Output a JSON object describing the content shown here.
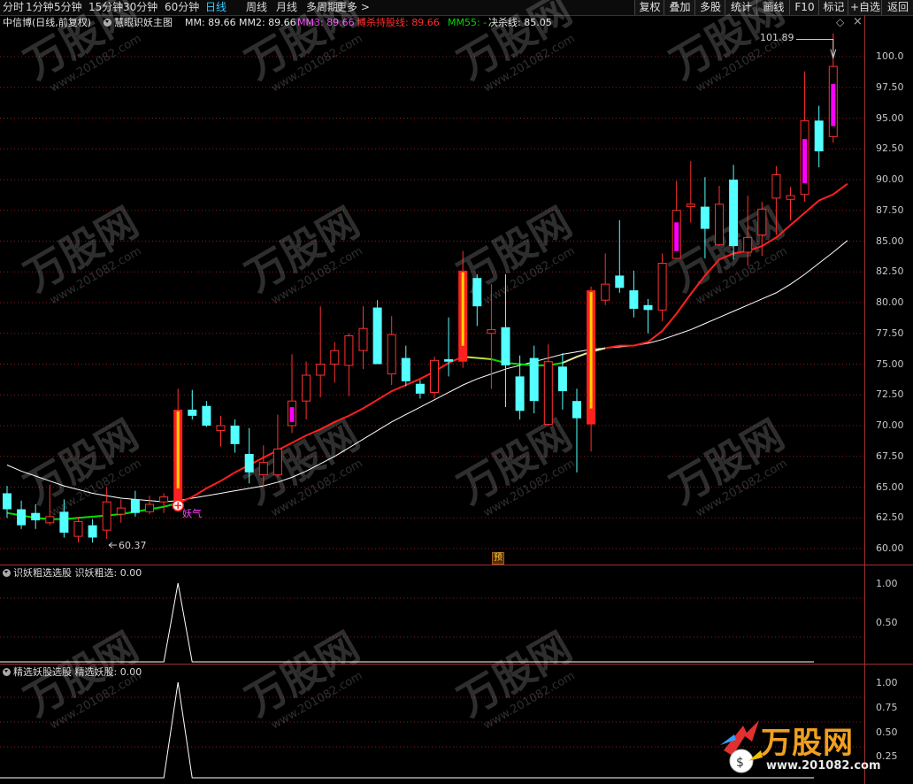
{
  "topbar": {
    "periods": [
      "分时",
      "1分钟",
      "5分钟",
      "15分钟",
      "30分钟",
      "60分钟",
      "日线",
      "周线",
      "月线",
      "多周期",
      "更多 >"
    ],
    "active_period": "日线",
    "right_buttons": [
      "复权",
      "叠加",
      "多股",
      "统计",
      "画线",
      "F10",
      "标记",
      "+自选",
      "返回"
    ]
  },
  "indicator_line": {
    "stock": "中信博(日线,前复权)",
    "indicator_name": "慧眼识妖主图",
    "mm": "MM: 89.66",
    "mm2": "MM2: 89.66",
    "mm3": "MM3: 89.66",
    "bosha": "博杀持股线: 89.66",
    "mm55": "MM55: -",
    "jueshaxian": "决杀线: 85.05"
  },
  "main_chart": {
    "y_ticks": [
      "100.0",
      "97.50",
      "95.00",
      "92.50",
      "90.00",
      "87.50",
      "85.00",
      "82.50",
      "80.00",
      "77.50",
      "75.00",
      "72.50",
      "70.00",
      "67.50",
      "65.00",
      "62.50",
      "60.00"
    ],
    "high_label": "101.89",
    "low_label": "60.37",
    "signal_label": "妖气",
    "pre_marker": "预"
  },
  "pane1": {
    "title": "识妖粗选选股",
    "value": "识妖粗选: 0.00",
    "y_ticks": [
      "1.00",
      "0.50"
    ]
  },
  "pane2": {
    "title": "精选妖股选股",
    "value": "精选妖股: 0.00",
    "y_ticks": [
      "1.00",
      "0.75",
      "0.50",
      "0.25"
    ]
  },
  "watermark": {
    "brand": "万股网",
    "url": "www.201082.com"
  },
  "colors": {
    "up": "#ff3030",
    "down": "#54ffff",
    "magenta": "#ff00ff",
    "bosha": "#ff2020",
    "mm55": "#00e000",
    "white_line": "#ffffff",
    "grid": "#8b1a1a"
  },
  "candles": [
    {
      "o": 64.5,
      "h": 65.1,
      "l": 62.5,
      "c": 63.2
    },
    {
      "o": 63.2,
      "h": 63.9,
      "l": 61.6,
      "c": 61.9
    },
    {
      "o": 62.9,
      "h": 63.6,
      "l": 61.6,
      "c": 62.3
    },
    {
      "o": 62.1,
      "h": 65.2,
      "l": 61.9,
      "c": 62.6
    },
    {
      "o": 63.0,
      "h": 64.0,
      "l": 60.9,
      "c": 61.3
    },
    {
      "o": 61.0,
      "h": 62.6,
      "l": 60.5,
      "c": 62.2
    },
    {
      "o": 61.9,
      "h": 62.4,
      "l": 60.5,
      "c": 60.9
    },
    {
      "o": 61.5,
      "h": 65.0,
      "l": 60.8,
      "c": 63.8
    },
    {
      "o": 62.8,
      "h": 64.0,
      "l": 62.1,
      "c": 63.3
    },
    {
      "o": 64.0,
      "h": 64.7,
      "l": 62.6,
      "c": 62.9
    },
    {
      "o": 63.0,
      "h": 64.3,
      "l": 62.8,
      "c": 63.6
    },
    {
      "o": 63.8,
      "h": 64.5,
      "l": 62.9,
      "c": 64.2
    },
    {
      "o": 63.6,
      "h": 73.0,
      "l": 63.3,
      "c": 71.3,
      "gold": true
    },
    {
      "o": 71.3,
      "h": 72.9,
      "l": 70.5,
      "c": 70.8
    },
    {
      "o": 71.6,
      "h": 72.0,
      "l": 69.9,
      "c": 70.0
    },
    {
      "o": 69.6,
      "h": 70.8,
      "l": 68.3,
      "c": 70.0
    },
    {
      "o": 70.0,
      "h": 70.5,
      "l": 67.8,
      "c": 68.5
    },
    {
      "o": 67.7,
      "h": 69.8,
      "l": 65.3,
      "c": 66.2
    },
    {
      "o": 66.0,
      "h": 68.4,
      "l": 65.0,
      "c": 67.0
    },
    {
      "o": 66.0,
      "h": 70.9,
      "l": 65.8,
      "c": 68.1
    },
    {
      "o": 70.0,
      "h": 75.8,
      "l": 69.4,
      "c": 72.0,
      "mag": true
    },
    {
      "o": 72.0,
      "h": 75.2,
      "l": 70.5,
      "c": 74.1
    },
    {
      "o": 74.1,
      "h": 79.7,
      "l": 72.3,
      "c": 75.0
    },
    {
      "o": 75.0,
      "h": 76.8,
      "l": 73.5,
      "c": 76.1
    },
    {
      "o": 74.9,
      "h": 77.5,
      "l": 72.4,
      "c": 77.3
    },
    {
      "o": 76.1,
      "h": 79.7,
      "l": 74.6,
      "c": 77.9
    },
    {
      "o": 79.6,
      "h": 80.2,
      "l": 75.0,
      "c": 75.0
    },
    {
      "o": 74.2,
      "h": 78.9,
      "l": 73.3,
      "c": 77.4
    },
    {
      "o": 75.5,
      "h": 76.5,
      "l": 73.2,
      "c": 73.6
    },
    {
      "o": 73.4,
      "h": 73.7,
      "l": 72.2,
      "c": 72.6
    },
    {
      "o": 72.7,
      "h": 75.6,
      "l": 72.2,
      "c": 75.3
    },
    {
      "o": 75.4,
      "h": 78.8,
      "l": 74.0,
      "c": 75.2
    },
    {
      "o": 75.2,
      "h": 84.2,
      "l": 74.7,
      "c": 82.6,
      "gold": true
    },
    {
      "o": 82.0,
      "h": 82.3,
      "l": 78.1,
      "c": 79.7
    },
    {
      "o": 77.5,
      "h": 81.5,
      "l": 73.0,
      "c": 77.8
    },
    {
      "o": 78.0,
      "h": 82.3,
      "l": 71.5,
      "c": 74.9
    },
    {
      "o": 74.0,
      "h": 75.7,
      "l": 70.5,
      "c": 71.2
    },
    {
      "o": 75.5,
      "h": 76.5,
      "l": 71.0,
      "c": 72.0
    },
    {
      "o": 70.1,
      "h": 76.6,
      "l": 70.0,
      "c": 75.2
    },
    {
      "o": 74.8,
      "h": 75.9,
      "l": 71.3,
      "c": 72.8
    },
    {
      "o": 72.0,
      "h": 73.0,
      "l": 66.2,
      "c": 70.6
    },
    {
      "o": 70.1,
      "h": 81.3,
      "l": 67.9,
      "c": 81.0,
      "gold": true
    },
    {
      "o": 80.2,
      "h": 84.0,
      "l": 79.8,
      "c": 81.5
    },
    {
      "o": 82.2,
      "h": 86.7,
      "l": 80.8,
      "c": 81.2
    },
    {
      "o": 81.0,
      "h": 82.6,
      "l": 78.8,
      "c": 79.5
    },
    {
      "o": 79.8,
      "h": 80.3,
      "l": 77.5,
      "c": 79.4
    },
    {
      "o": 79.4,
      "h": 84.0,
      "l": 78.5,
      "c": 83.2
    },
    {
      "o": 83.6,
      "h": 89.9,
      "l": 84.2,
      "c": 87.5,
      "mag": true
    },
    {
      "o": 87.8,
      "h": 91.5,
      "l": 86.5,
      "c": 88.0
    },
    {
      "o": 87.8,
      "h": 90.2,
      "l": 83.6,
      "c": 86.0
    },
    {
      "o": 84.7,
      "h": 89.5,
      "l": 84.6,
      "c": 88.0
    },
    {
      "o": 90.0,
      "h": 91.2,
      "l": 83.5,
      "c": 84.6
    },
    {
      "o": 84.1,
      "h": 88.7,
      "l": 83.0,
      "c": 85.3
    },
    {
      "o": 85.5,
      "h": 88.2,
      "l": 83.8,
      "c": 87.6
    },
    {
      "o": 88.5,
      "h": 91.1,
      "l": 85.5,
      "c": 90.4
    },
    {
      "o": 88.4,
      "h": 89.4,
      "l": 86.7,
      "c": 88.7
    },
    {
      "o": 88.8,
      "h": 98.8,
      "l": 88.2,
      "c": 94.8,
      "mag": true
    },
    {
      "o": 94.8,
      "h": 96.0,
      "l": 91.0,
      "c": 92.3
    },
    {
      "o": 93.5,
      "h": 101.9,
      "l": 93.0,
      "c": 99.2,
      "mag": true
    }
  ],
  "series_bosha": [
    62.9,
    62.7,
    62.5,
    62.4,
    62.4,
    62.5,
    62.6,
    62.7,
    62.8,
    63.0,
    63.2,
    63.4,
    63.7,
    64.2,
    64.9,
    65.5,
    66.2,
    66.8,
    67.4,
    68.0,
    68.6,
    69.2,
    69.7,
    70.3,
    70.8,
    71.4,
    72.1,
    72.8,
    73.3,
    73.8,
    74.4,
    75.1,
    75.6,
    75.5,
    75.4,
    75.1,
    75.0,
    74.9,
    74.9,
    75.1,
    75.6,
    76.0,
    76.3,
    76.5,
    76.5,
    76.8,
    77.7,
    79.1,
    80.7,
    82.2,
    83.5,
    84.0,
    84.2,
    84.6,
    85.3,
    86.3,
    87.3,
    88.3,
    88.8,
    89.66
  ],
  "series_white": [
    66.8,
    66.3,
    65.9,
    65.5,
    65.1,
    64.8,
    64.5,
    64.3,
    64.1,
    64.0,
    63.9,
    63.8,
    63.9,
    64.1,
    64.3,
    64.5,
    64.7,
    64.9,
    65.1,
    65.4,
    65.8,
    66.3,
    66.9,
    67.5,
    68.2,
    68.9,
    69.6,
    70.3,
    70.9,
    71.5,
    72.1,
    72.7,
    73.3,
    73.8,
    74.2,
    74.6,
    74.9,
    75.2,
    75.5,
    75.8,
    76.0,
    76.2,
    76.3,
    76.4,
    76.5,
    76.7,
    77.0,
    77.4,
    77.8,
    78.3,
    78.8,
    79.3,
    79.8,
    80.3,
    80.8,
    81.5,
    82.3,
    83.2,
    84.1,
    85.05
  ]
}
